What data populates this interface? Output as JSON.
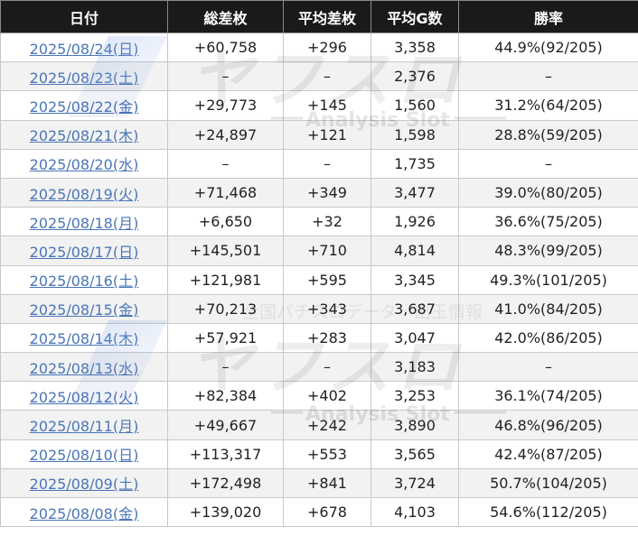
{
  "table": {
    "headers": [
      "日付",
      "総差枚",
      "平均差枚",
      "平均G数",
      "勝率"
    ],
    "rows": [
      {
        "date": "2025/08/24(日)",
        "total": "+60,758",
        "avg_diff": "+296",
        "avg_games": "3,358",
        "win_rate": "44.9%(92/205)"
      },
      {
        "date": "2025/08/23(土)",
        "total": "–",
        "avg_diff": "–",
        "avg_games": "2,376",
        "win_rate": "–"
      },
      {
        "date": "2025/08/22(金)",
        "total": "+29,773",
        "avg_diff": "+145",
        "avg_games": "1,560",
        "win_rate": "31.2%(64/205)"
      },
      {
        "date": "2025/08/21(木)",
        "total": "+24,897",
        "avg_diff": "+121",
        "avg_games": "1,598",
        "win_rate": "28.8%(59/205)"
      },
      {
        "date": "2025/08/20(水)",
        "total": "–",
        "avg_diff": "–",
        "avg_games": "1,735",
        "win_rate": "–"
      },
      {
        "date": "2025/08/19(火)",
        "total": "+71,468",
        "avg_diff": "+349",
        "avg_games": "3,477",
        "win_rate": "39.0%(80/205)"
      },
      {
        "date": "2025/08/18(月)",
        "total": "+6,650",
        "avg_diff": "+32",
        "avg_games": "1,926",
        "win_rate": "36.6%(75/205)"
      },
      {
        "date": "2025/08/17(日)",
        "total": "+145,501",
        "avg_diff": "+710",
        "avg_games": "4,814",
        "win_rate": "48.3%(99/205)"
      },
      {
        "date": "2025/08/16(土)",
        "total": "+121,981",
        "avg_diff": "+595",
        "avg_games": "3,345",
        "win_rate": "49.3%(101/205)"
      },
      {
        "date": "2025/08/15(金)",
        "total": "+70,213",
        "avg_diff": "+343",
        "avg_games": "3,687",
        "win_rate": "41.0%(84/205)"
      },
      {
        "date": "2025/08/14(木)",
        "total": "+57,921",
        "avg_diff": "+283",
        "avg_games": "3,047",
        "win_rate": "42.0%(86/205)"
      },
      {
        "date": "2025/08/13(水)",
        "total": "–",
        "avg_diff": "–",
        "avg_games": "3,183",
        "win_rate": "–"
      },
      {
        "date": "2025/08/12(火)",
        "total": "+82,384",
        "avg_diff": "+402",
        "avg_games": "3,253",
        "win_rate": "36.1%(74/205)"
      },
      {
        "date": "2025/08/11(月)",
        "total": "+49,667",
        "avg_diff": "+242",
        "avg_games": "3,890",
        "win_rate": "46.8%(96/205)"
      },
      {
        "date": "2025/08/10(日)",
        "total": "+113,317",
        "avg_diff": "+553",
        "avg_games": "3,565",
        "win_rate": "42.4%(87/205)"
      },
      {
        "date": "2025/08/09(土)",
        "total": "+172,498",
        "avg_diff": "+841",
        "avg_games": "3,724",
        "win_rate": "50.7%(104/205)"
      },
      {
        "date": "2025/08/08(金)",
        "total": "+139,020",
        "avg_diff": "+678",
        "avg_games": "4,103",
        "win_rate": "54.6%(112/205)"
      }
    ]
  },
  "watermark": {
    "logo_text": "ヤフスロ",
    "tagline": "Analysis Slot",
    "subtitle": "全国パチスロデータ・出玉情報"
  }
}
